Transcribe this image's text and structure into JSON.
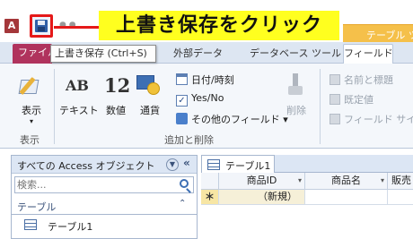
{
  "annotation": {
    "callout_text": "上書き保存をクリック"
  },
  "title_bar": {
    "app_letter": "A",
    "context_tab_label": "テーブル ツ"
  },
  "tooltip": {
    "text": "上書き保存 (Ctrl+S)"
  },
  "ribbon_tabs": {
    "file": "ファイル",
    "external_data": "外部データ",
    "database_tools": "データベース ツール",
    "fields": "フィールド"
  },
  "ribbon": {
    "view_label": "表示",
    "view_group_label": "表示",
    "text_icon": "AB",
    "text_label": "テキスト",
    "number_icon": "12",
    "number_label": "数値",
    "currency_label": "通貨",
    "date_time_label": "日付/時刻",
    "yes_no_label": "Yes/No",
    "more_fields_label": "その他のフィールド ▾",
    "delete_label": "削除",
    "add_delete_group_label": "追加と削除",
    "name_caption_label": "名前と標題",
    "default_value_label": "既定値",
    "field_size_label": "フィールド サイズ"
  },
  "nav_pane": {
    "title": "すべての Access オブジェクト",
    "search_placeholder": "検索...",
    "group_label": "テーブル",
    "items": [
      "テーブル1"
    ]
  },
  "document": {
    "tab_label": "テーブル1",
    "columns": [
      "商品ID",
      "商品名",
      "販売"
    ],
    "new_row_marker": "＊",
    "new_row_value": "（新規）"
  },
  "colors": {
    "accent_file_tab": "#b0335d",
    "callout_background": "#ffff1f",
    "highlight_border": "#e51919",
    "context_tab": "#f5c04a"
  }
}
